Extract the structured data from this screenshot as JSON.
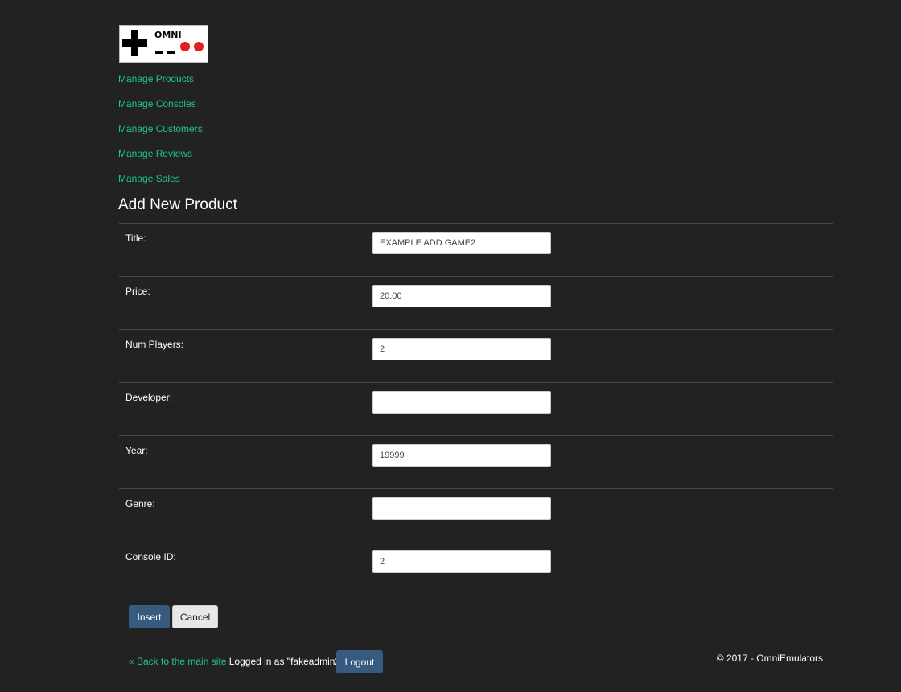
{
  "logo": {
    "text": "OMNI"
  },
  "nav": {
    "items": [
      {
        "label": "Manage Products"
      },
      {
        "label": "Manage Consoles"
      },
      {
        "label": "Manage Customers"
      },
      {
        "label": "Manage Reviews"
      },
      {
        "label": "Manage Sales"
      }
    ]
  },
  "page": {
    "title": "Add New Product"
  },
  "form": {
    "fields": [
      {
        "label": "Title:",
        "value": "EXAMPLE ADD GAME2"
      },
      {
        "label": "Price:",
        "value": "20.00"
      },
      {
        "label": "Num Players:",
        "value": "2"
      },
      {
        "label": "Developer:",
        "value": ""
      },
      {
        "label": "Year:",
        "value": "19999"
      },
      {
        "label": "Genre:",
        "value": ""
      },
      {
        "label": "Console ID:",
        "value": "2"
      }
    ],
    "insert_label": "Insert",
    "cancel_label": "Cancel"
  },
  "footer": {
    "back_link": "« Back to the main site",
    "logged_in_text": "Logged in as \"fakeadmin2\"",
    "logout_label": "Logout",
    "copyright": "© 2017 - OmniEmulators"
  },
  "colors": {
    "background": "#222222",
    "link": "#1fc58e",
    "primary_button": "#375a7f",
    "secondary_button": "#e8e8e8"
  }
}
